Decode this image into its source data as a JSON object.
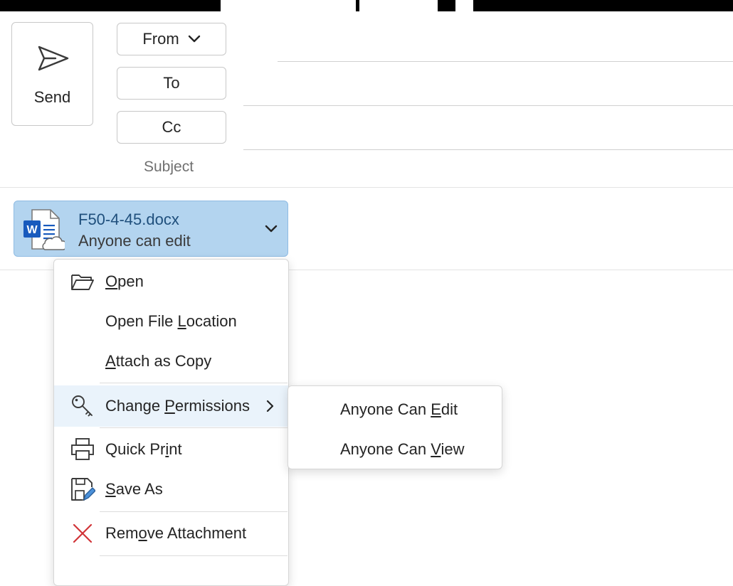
{
  "compose": {
    "send_label": "Send",
    "from_label": "From",
    "to_label": "To",
    "cc_label": "Cc",
    "subject_label": "Subject"
  },
  "attachment": {
    "file_name": "F50-4-45.docx",
    "permission": "Anyone can edit",
    "icon": "word-document-cloud-icon",
    "accent_color": "#b3d4ef"
  },
  "context_menu": {
    "items": [
      {
        "pre": "",
        "key": "O",
        "post": "pen",
        "icon": "folder-open-icon"
      },
      {
        "pre": "Open File ",
        "key": "L",
        "post": "ocation",
        "icon": ""
      },
      {
        "pre": "",
        "key": "A",
        "post": "ttach as Copy",
        "icon": ""
      },
      {
        "pre": "Change ",
        "key": "P",
        "post": "ermissions",
        "icon": "key-icon"
      },
      {
        "pre": "Quick Pr",
        "key": "i",
        "post": "nt",
        "icon": "printer-icon"
      },
      {
        "pre": "",
        "key": "S",
        "post": "ave As",
        "icon": "save-as-icon"
      },
      {
        "pre": "Rem",
        "key": "o",
        "post": "ve Attachment",
        "icon": "remove-icon"
      }
    ]
  },
  "permissions_submenu": {
    "items": [
      {
        "pre": "Anyone Can ",
        "key": "E",
        "post": "dit"
      },
      {
        "pre": "Anyone Can ",
        "key": "V",
        "post": "iew"
      }
    ]
  },
  "colors": {
    "remove_icon": "#d13438",
    "word_blue": "#185abd",
    "hover_bg": "#eaf3fb"
  }
}
